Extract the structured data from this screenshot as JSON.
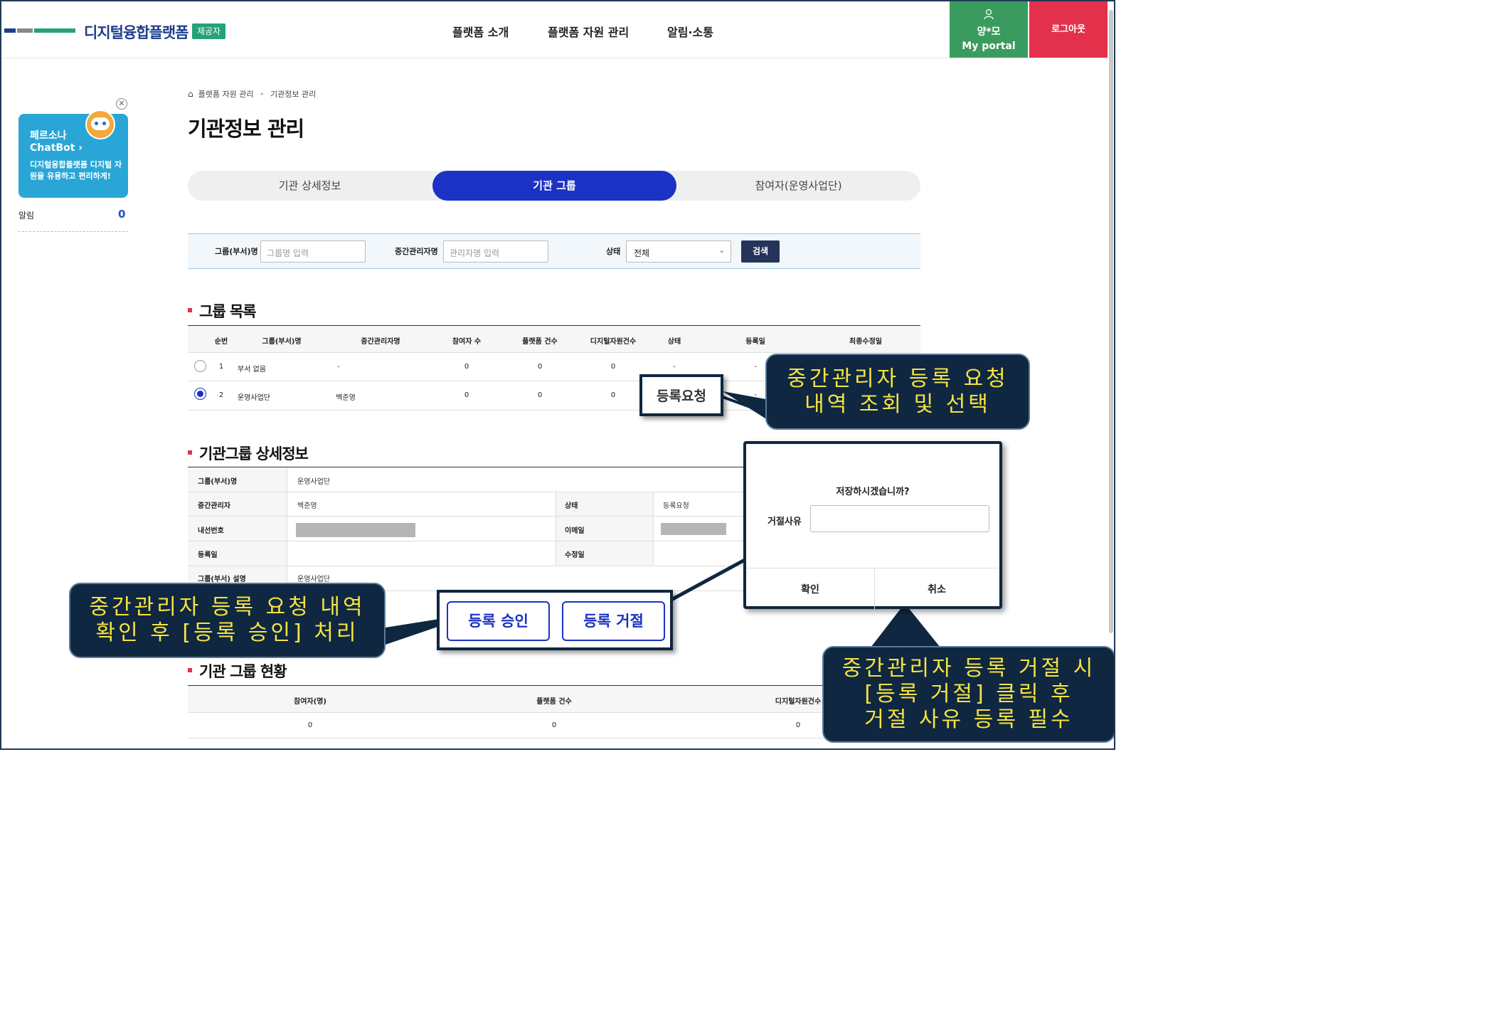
{
  "header": {
    "logo_text": "디지털융합플랫폼",
    "logo_badge": "제공자",
    "nav": [
      "플랫폼 소개",
      "플랫폼 자원 관리",
      "알림·소통"
    ],
    "user_name": "양*모",
    "portal_label": "My portal",
    "logout_label": "로그아웃"
  },
  "sidebar": {
    "chatbot_title": "페르소나",
    "chatbot_name": "ChatBot",
    "chatbot_desc": "디지털융합플랫폼 디지털 자원을 유용하고 편리하게!",
    "alarm_label": "알림",
    "alarm_count": "0"
  },
  "breadcrumb": {
    "level1": "플랫폼 자원 관리",
    "level2": "기관정보 관리"
  },
  "page_title": "기관정보 관리",
  "tabs": [
    {
      "label": "기관 상세정보",
      "active": false
    },
    {
      "label": "기관 그룹",
      "active": true
    },
    {
      "label": "참여자(운영사업단)",
      "active": false
    }
  ],
  "search": {
    "group_label": "그룹(부서)명",
    "group_placeholder": "그룹명 입력",
    "manager_label": "중간관리자명",
    "manager_placeholder": "관리자명 입력",
    "status_label": "상태",
    "status_value": "전체",
    "search_button": "검색"
  },
  "group_list": {
    "title": "그룹 목록",
    "columns": [
      "순번",
      "그룹(부서)명",
      "중간관리자명",
      "참여자 수",
      "플랫폼 건수",
      "디지털자원건수",
      "상태",
      "등록일",
      "최종수정일"
    ],
    "rows": [
      {
        "no": "1",
        "group": "부서 없음",
        "manager": "-",
        "participants": "0",
        "platforms": "0",
        "resources": "0",
        "status": "-",
        "reg_date": "-",
        "selected": false
      },
      {
        "no": "2",
        "group": "운영사업단",
        "manager": "백준영",
        "participants": "0",
        "platforms": "0",
        "resources": "0",
        "status": "등록요청",
        "reg_date": "-",
        "selected": true
      }
    ]
  },
  "detail": {
    "title": "기관그룹 상세정보",
    "group_label": "그룹(부서)명",
    "group_value": "운영사업단",
    "manager_label": "중간관리자",
    "manager_value": "백준영",
    "state_label": "상태",
    "state_value": "등록요청",
    "phone_label": "내선번호",
    "email_label": "이메일",
    "reg_label": "등록일",
    "mod_label": "수정일",
    "desc_label": "그룹(부서) 설명",
    "desc_value": "운영사업단"
  },
  "actions": {
    "approve": "등록 승인",
    "reject": "등록 거절"
  },
  "status_section": {
    "title": "기관 그룹 현황",
    "columns": [
      "참여자(명)",
      "플랫폼 건수",
      "디지털자원건수"
    ],
    "values": [
      "0",
      "0",
      "0"
    ]
  },
  "dialog": {
    "question": "저장하시겠습니까?",
    "reason_label": "거절사유",
    "confirm": "확인",
    "cancel": "취소"
  },
  "callouts": {
    "c1_line1": "중간관리자 등록 요청",
    "c1_line2": "내역 조회 및 선택",
    "c2_line1": "중간관리자 등록 요청 내역",
    "c2_line2": "확인 후 [등록 승인] 처리",
    "c3_line1": "중간관리자 등록 거절 시",
    "c3_line2": "[등록 거절] 클릭 후",
    "c3_line3": "거절 사유 등록 필수",
    "status_zoom": "등록요청"
  },
  "colors": {
    "primary": "#1c32c4",
    "portal": "#3a9b5e",
    "logout": "#e3314b",
    "callout_bg": "#0f2740",
    "callout_text": "#f5e342"
  }
}
